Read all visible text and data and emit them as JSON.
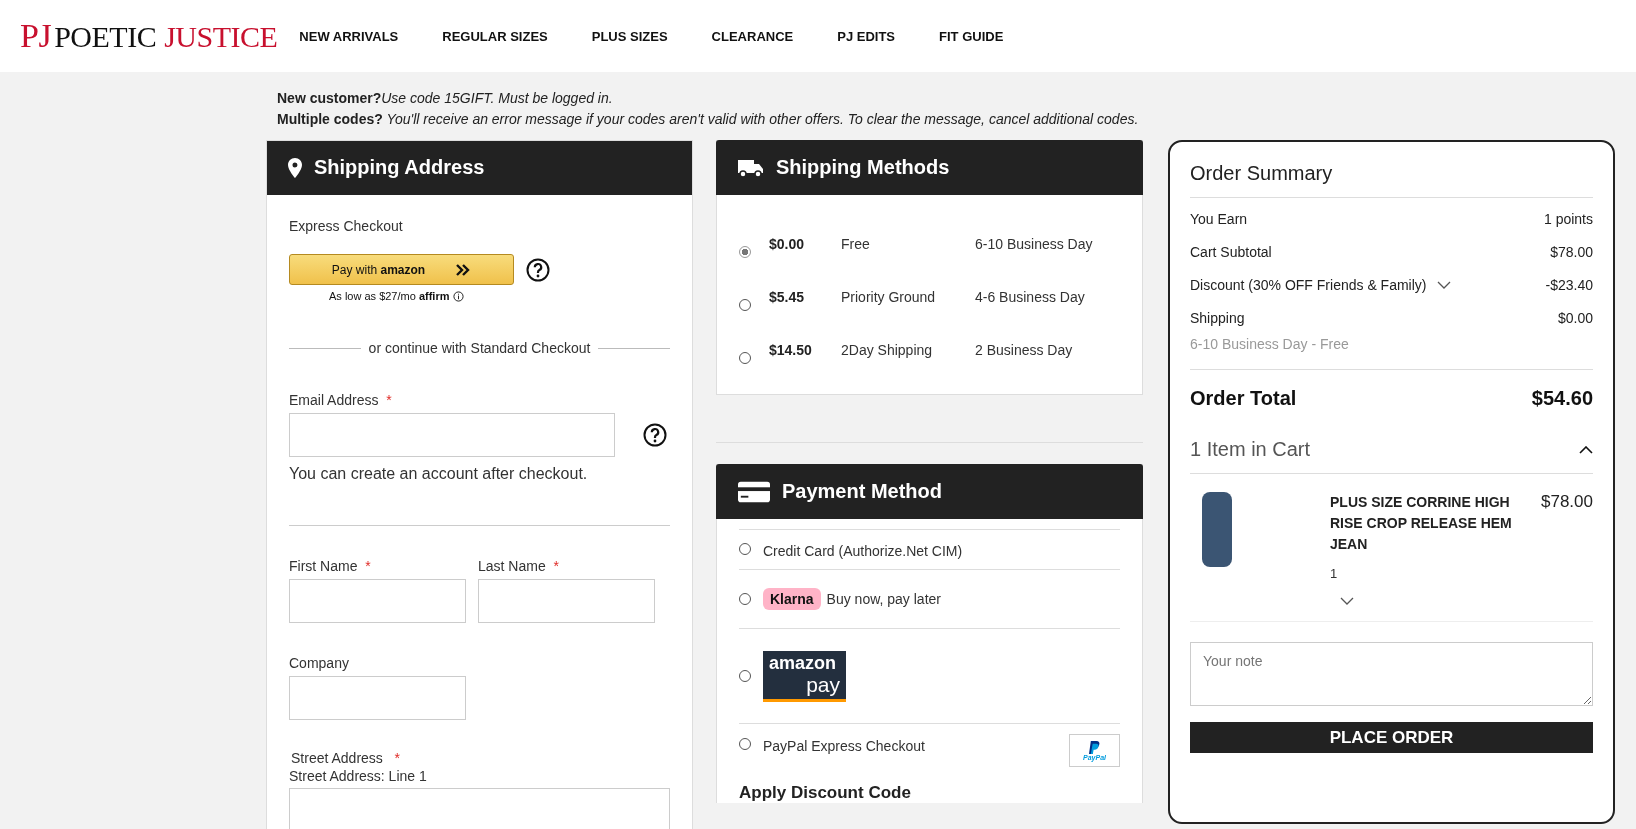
{
  "logo": {
    "monogram": "PJ",
    "word_1": "POETIC",
    "word_2": "JUSTICE"
  },
  "nav": [
    "NEW ARRIVALS",
    "REGULAR SIZES",
    "PLUS SIZES",
    "CLEARANCE",
    "PJ EDITS",
    "FIT GUIDE"
  ],
  "notices": [
    {
      "lead": "New customer?",
      "text": "Use code 15GIFT. Must be logged in."
    },
    {
      "lead": "Multiple codes?",
      "text": " You'll receive an error message if your codes aren't valid with other offers. To clear the message, cancel additional codes."
    }
  ],
  "shipping_address": {
    "title": "Shipping Address",
    "express_label": "Express Checkout",
    "amazon_button": "Pay with **amazon**",
    "affirm_note": "As low as $27/mo **affirm**",
    "divider_text": "or continue with Standard Checkout",
    "email": {
      "label": "Email Address",
      "required_mark": "*",
      "hint": "You can create an account after checkout."
    },
    "name_fields": [
      {
        "label": "First Name",
        "required_mark": "*"
      },
      {
        "label": "Last Name",
        "required_mark": "*"
      }
    ],
    "company": {
      "label": "Company"
    },
    "street": {
      "label": "Street Address",
      "required_mark": "*",
      "sublabel": "Street Address: Line 1"
    }
  },
  "shipping_methods": {
    "title": "Shipping Methods",
    "rows": [
      {
        "selected": true,
        "price": "$0.00",
        "name": "Free",
        "time": "6-10 Business Day"
      },
      {
        "selected": false,
        "price": "$5.45",
        "name": "Priority Ground",
        "time": "4-6 Business Day"
      },
      {
        "selected": false,
        "price": "$14.50",
        "name": "2Day Shipping",
        "time": "2 Business Day"
      }
    ]
  },
  "payment_method": {
    "title": "Payment Method",
    "options": [
      {
        "kind": "text",
        "selected": false,
        "label": "Credit Card (Authorize.Net CIM)"
      },
      {
        "kind": "klarna",
        "selected": false,
        "badge": "Klarna",
        "label": "Buy now, pay later"
      },
      {
        "kind": "amazon_pay",
        "selected": false,
        "logo_top": "amazon",
        "logo_bottom": "pay"
      },
      {
        "kind": "paypal",
        "selected": false,
        "label": "PayPal Express Checkout",
        "logo": "PayPal"
      }
    ],
    "discount_heading": "Apply Discount Code"
  },
  "order_summary": {
    "title": "Order Summary",
    "rows": [
      {
        "kind": "plain",
        "label": "You Earn",
        "value": "1 points"
      },
      {
        "kind": "plain",
        "label": "Cart Subtotal",
        "value": "$78.00"
      },
      {
        "kind": "expandable",
        "label": "Discount (30% OFF Friends & Family)",
        "value": "-$23.40"
      },
      {
        "kind": "plain",
        "label": "Shipping",
        "value": "$0.00"
      }
    ],
    "shipping_note": "6-10 Business Day - Free",
    "total_label": "Order Total",
    "total_value": "$54.60",
    "cart_header": "1 Item in Cart",
    "cart_expanded": true,
    "item": {
      "name": "PLUS SIZE CORRINE HIGH RISE CROP RELEASE HEM JEAN",
      "price": "$78.00",
      "qty": "1"
    },
    "note_placeholder": "Your note",
    "button": "PLACE ORDER"
  }
}
